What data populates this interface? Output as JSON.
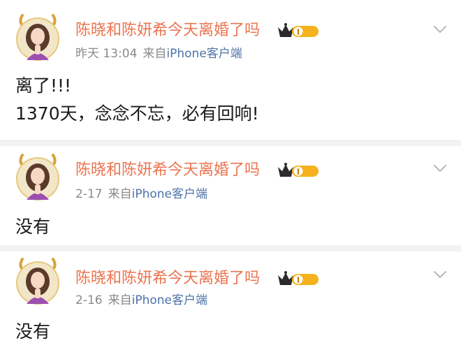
{
  "posts": [
    {
      "username": "陈晓和陈妍希今天离婚了吗",
      "time": "昨天 13:04",
      "source_prefix": "来自",
      "source": "iPhone客户端",
      "content_lines": [
        "离了!!!",
        "1370天，念念不忘，必有回响!"
      ]
    },
    {
      "username": "陈晓和陈妍希今天离婚了吗",
      "time": "2-17",
      "source_prefix": "来自",
      "source": "iPhone客户端",
      "content_lines": [
        "没有"
      ]
    },
    {
      "username": "陈晓和陈妍希今天离婚了吗",
      "time": "2-16",
      "source_prefix": "来自",
      "source": "iPhone客户端",
      "content_lines": [
        "没有"
      ]
    }
  ],
  "badge": {
    "text": "I",
    "icon": "crown-level-badge-icon"
  },
  "colors": {
    "username": "#eb7350",
    "meta": "#8a8a8a",
    "source_link": "#4d73a8",
    "badge_gold": "#f5b21c",
    "divider": "#f2f2f2"
  }
}
